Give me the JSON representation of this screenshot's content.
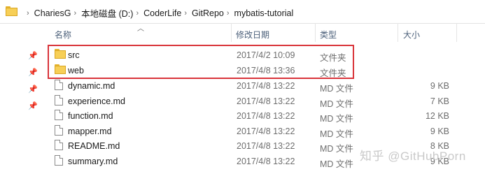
{
  "breadcrumb": [
    "ChariesG",
    "本地磁盘 (D:)",
    "CoderLife",
    "GitRepo",
    "mybatis-tutorial"
  ],
  "columns": {
    "name": "名称",
    "date": "修改日期",
    "type": "类型",
    "size": "大小"
  },
  "files": [
    {
      "name": "src",
      "date": "2017/4/2 10:09",
      "type": "文件夹",
      "size": "",
      "icon": "folder-icon"
    },
    {
      "name": "web",
      "date": "2017/4/8 13:36",
      "type": "文件夹",
      "size": "",
      "icon": "folder-icon"
    },
    {
      "name": "dynamic.md",
      "date": "2017/4/8 13:22",
      "type": "MD 文件",
      "size": "9 KB",
      "icon": "file-icon"
    },
    {
      "name": "experience.md",
      "date": "2017/4/8 13:22",
      "type": "MD 文件",
      "size": "7 KB",
      "icon": "file-icon"
    },
    {
      "name": "function.md",
      "date": "2017/4/8 13:22",
      "type": "MD 文件",
      "size": "12 KB",
      "icon": "file-icon"
    },
    {
      "name": "mapper.md",
      "date": "2017/4/8 13:22",
      "type": "MD 文件",
      "size": "9 KB",
      "icon": "file-icon"
    },
    {
      "name": "README.md",
      "date": "2017/4/8 13:22",
      "type": "MD 文件",
      "size": "8 KB",
      "icon": "file-icon"
    },
    {
      "name": "summary.md",
      "date": "2017/4/8 13:22",
      "type": "MD 文件",
      "size": "9 KB",
      "icon": "file-icon"
    }
  ],
  "watermark": "知乎 @GitHubPorn",
  "colors": {
    "highlight": "#d9343a",
    "folder": "#f7cf57",
    "header_text": "#4c607a"
  }
}
